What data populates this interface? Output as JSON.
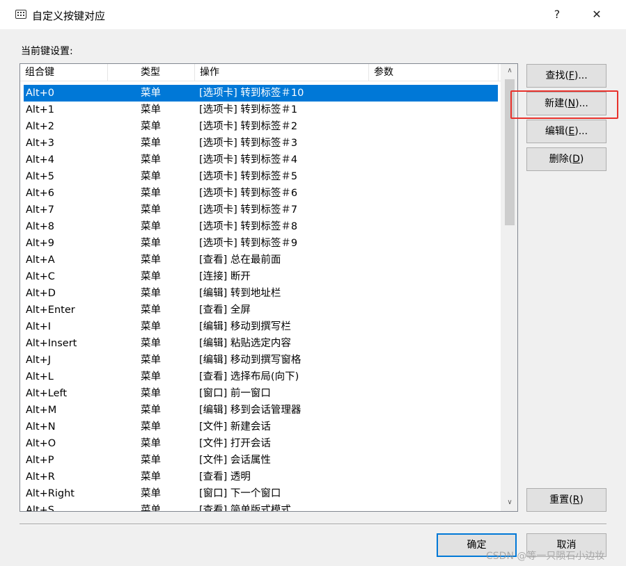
{
  "window": {
    "title": "自定义按键对应",
    "help_glyph": "?",
    "close_glyph": "✕",
    "icon": "keyboard-icon"
  },
  "section_label": "当前键设置:",
  "columns": [
    "组合键",
    "类型",
    "操作",
    "参数"
  ],
  "rows": [
    {
      "key": "Alt+0",
      "type": "菜单",
      "action": "[选项卡] 转到标签＃10",
      "param": "",
      "selected": true
    },
    {
      "key": "Alt+1",
      "type": "菜单",
      "action": "[选项卡] 转到标签＃1",
      "param": ""
    },
    {
      "key": "Alt+2",
      "type": "菜单",
      "action": "[选项卡] 转到标签＃2",
      "param": ""
    },
    {
      "key": "Alt+3",
      "type": "菜单",
      "action": "[选项卡] 转到标签＃3",
      "param": ""
    },
    {
      "key": "Alt+4",
      "type": "菜单",
      "action": "[选项卡] 转到标签＃4",
      "param": ""
    },
    {
      "key": "Alt+5",
      "type": "菜单",
      "action": "[选项卡] 转到标签＃5",
      "param": ""
    },
    {
      "key": "Alt+6",
      "type": "菜单",
      "action": "[选项卡] 转到标签＃6",
      "param": ""
    },
    {
      "key": "Alt+7",
      "type": "菜单",
      "action": "[选项卡] 转到标签＃7",
      "param": ""
    },
    {
      "key": "Alt+8",
      "type": "菜单",
      "action": "[选项卡] 转到标签＃8",
      "param": ""
    },
    {
      "key": "Alt+9",
      "type": "菜单",
      "action": "[选项卡] 转到标签＃9",
      "param": ""
    },
    {
      "key": "Alt+A",
      "type": "菜单",
      "action": "[查看] 总在最前面",
      "param": ""
    },
    {
      "key": "Alt+C",
      "type": "菜单",
      "action": "[连接] 断开",
      "param": ""
    },
    {
      "key": "Alt+D",
      "type": "菜单",
      "action": "[编辑] 转到地址栏",
      "param": ""
    },
    {
      "key": "Alt+Enter",
      "type": "菜单",
      "action": "[查看] 全屏",
      "param": ""
    },
    {
      "key": "Alt+I",
      "type": "菜单",
      "action": "[编辑] 移动到撰写栏",
      "param": ""
    },
    {
      "key": "Alt+Insert",
      "type": "菜单",
      "action": "[编辑] 粘贴选定内容",
      "param": ""
    },
    {
      "key": "Alt+J",
      "type": "菜单",
      "action": "[编辑] 移动到撰写窗格",
      "param": ""
    },
    {
      "key": "Alt+L",
      "type": "菜单",
      "action": "[查看] 选择布局(向下)",
      "param": ""
    },
    {
      "key": "Alt+Left",
      "type": "菜单",
      "action": "[窗口] 前一窗口",
      "param": ""
    },
    {
      "key": "Alt+M",
      "type": "菜单",
      "action": "[编辑] 移到会话管理器",
      "param": ""
    },
    {
      "key": "Alt+N",
      "type": "菜单",
      "action": "[文件] 新建会话",
      "param": ""
    },
    {
      "key": "Alt+O",
      "type": "菜单",
      "action": "[文件] 打开会话",
      "param": ""
    },
    {
      "key": "Alt+P",
      "type": "菜单",
      "action": "[文件] 会话属性",
      "param": ""
    },
    {
      "key": "Alt+R",
      "type": "菜单",
      "action": "[查看] 透明",
      "param": ""
    },
    {
      "key": "Alt+Right",
      "type": "菜单",
      "action": "[窗口] 下一个窗口",
      "param": ""
    },
    {
      "key": "Alt+S",
      "type": "菜单",
      "action": "[查看] 简单版式模式",
      "param": ""
    }
  ],
  "buttons": {
    "find": {
      "text": "查找(",
      "mnemonic": "F",
      "suffix": ")..."
    },
    "new": {
      "text": "新建(",
      "mnemonic": "N",
      "suffix": ")..."
    },
    "edit": {
      "text": "编辑(",
      "mnemonic": "E",
      "suffix": ")..."
    },
    "delete": {
      "text": "删除(",
      "mnemonic": "D",
      "suffix": ")"
    },
    "reset": {
      "text": "重置(",
      "mnemonic": "R",
      "suffix": ")"
    },
    "ok": "确定",
    "cancel": "取消"
  },
  "scrollbar": {
    "up_glyph": "∧",
    "down_glyph": "∨",
    "position": 0.0
  },
  "watermark": "CSDN @等一只陨石小边妆",
  "colors": {
    "selection": "#0078d7",
    "highlight_box": "#e8312b",
    "default_button_border": "#0078d7"
  }
}
